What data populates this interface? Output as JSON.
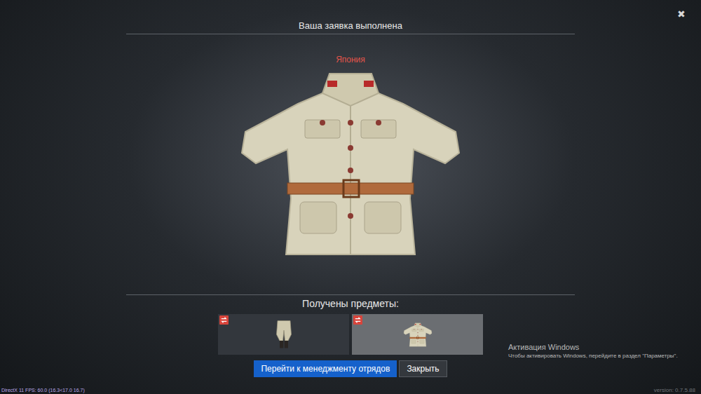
{
  "dialog": {
    "title": "Ваша заявка выполнена",
    "close": "✖",
    "nation": "Япония"
  },
  "received": {
    "heading": "Получены предметы:",
    "items": [
      {
        "kind": "trousers",
        "selected": false
      },
      {
        "kind": "jacket",
        "selected": true
      }
    ]
  },
  "buttons": [
    {
      "label": "Перейти к менеджменту отрядов",
      "kind": "primary"
    },
    {
      "label": "Закрыть",
      "kind": "secondary"
    }
  ],
  "watermark": {
    "title": "Активация Windows",
    "text": "Чтобы активировать Windows, перейдите в раздел \"Параметры\"."
  },
  "status": {
    "fps": "DirectX 11 FPS: 60.0 (16.3<17.0 16.7)",
    "version": "version: 0.7.5.88"
  }
}
